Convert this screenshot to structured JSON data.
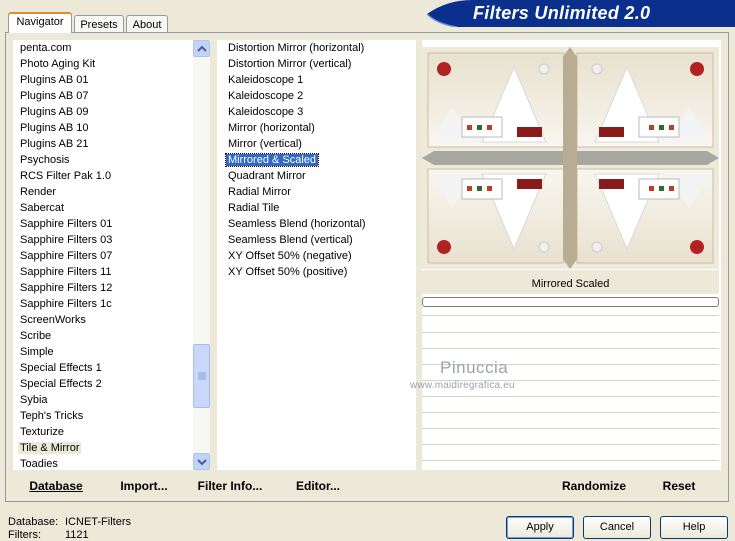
{
  "tabs": [
    {
      "label": "Navigator",
      "active": true
    },
    {
      "label": "Presets",
      "active": false
    },
    {
      "label": "About",
      "active": false
    }
  ],
  "banner_title": "Filters Unlimited 2.0",
  "categories": [
    "penta.com",
    "Photo Aging Kit",
    "Plugins AB 01",
    "Plugins AB 07",
    "Plugins AB 09",
    "Plugins AB 10",
    "Plugins AB 21",
    "Psychosis",
    "RCS Filter Pak 1.0",
    "Render",
    "Sabercat",
    "Sapphire Filters 01",
    "Sapphire Filters 03",
    "Sapphire Filters 07",
    "Sapphire Filters 11",
    "Sapphire Filters 12",
    "Sapphire Filters 1c",
    "ScreenWorks",
    "Scribe",
    "Simple",
    "Special Effects 1",
    "Special Effects 2",
    "Sybia",
    "Teph's Tricks",
    "Texturize",
    "Tile & Mirror",
    "Toadies"
  ],
  "selected_category": "Tile & Mirror",
  "filters": [
    "Distortion Mirror (horizontal)",
    "Distortion Mirror (vertical)",
    "Kaleidoscope 1",
    "Kaleidoscope 2",
    "Kaleidoscope 3",
    "Mirror (horizontal)",
    "Mirror (vertical)",
    "Mirrored & Scaled",
    "Quadrant Mirror",
    "Radial Mirror",
    "Radial Tile",
    "Seamless Blend (horizontal)",
    "Seamless Blend (vertical)",
    "XY Offset 50% (negative)",
    "XY Offset 50% (positive)"
  ],
  "selected_filter": "Mirrored & Scaled",
  "preview_label": "Mirrored  Scaled",
  "watermark": {
    "name": "Pinuccia",
    "url": "www.maidiregrafica.eu"
  },
  "bottom_buttons": {
    "database": "Database",
    "import": "Import...",
    "filter_info": "Filter Info...",
    "editor": "Editor...",
    "randomize": "Randomize",
    "reset": "Reset"
  },
  "status": {
    "database_label": "Database:",
    "database_value": "ICNET-Filters",
    "filters_label": "Filters:",
    "filters_value": "1121"
  },
  "dialog_buttons": {
    "apply": "Apply",
    "cancel": "Cancel",
    "help": "Help"
  },
  "colors": {
    "banner": "#0a2f8c",
    "selection": "#316ac5",
    "tab_accent": "#e68b2c"
  }
}
